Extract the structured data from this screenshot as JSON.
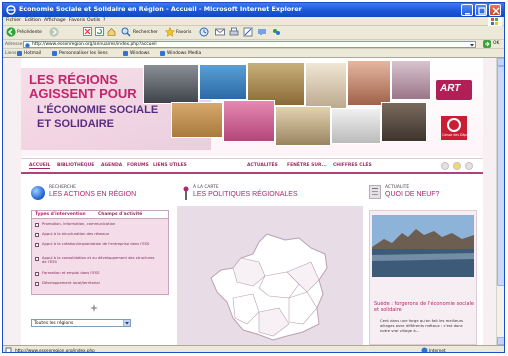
{
  "window": {
    "title": "Economie Sociale et Solidaire en Région - Accueil - Microsoft Internet Explorer"
  },
  "menu": [
    "Fichier",
    "Edition",
    "Affichage",
    "Favoris",
    "Outils",
    "?"
  ],
  "toolbar": {
    "back_label": "Précédente",
    "search_label": "Rechercher",
    "favorites_label": "Favoris"
  },
  "address": {
    "label": "Adresse",
    "url": "http://www.essenregion.org/annuaires/index.php?accueil",
    "go_label": "OK"
  },
  "links": {
    "label": "Liens",
    "items": [
      "Hotmail",
      "Personnaliser les liens",
      "Windows",
      "Windows Media"
    ]
  },
  "hero": {
    "line1": "LES RÉGIONS",
    "line2": "AGISSENT POUR",
    "line3": "L'ÉCONOMIE SOCIALE",
    "line4": "ET SOLIDAIRE",
    "art_logo": "ART",
    "cdc_logo": "Caisse des Dépôts"
  },
  "nav": {
    "items": [
      "ACCUEIL",
      "BIBLIOTHÈQUE",
      "AGENDA",
      "FORUMS",
      "LIENS UTILES",
      "ACTUALITÉS",
      "FENÊTRE SUR...",
      "CHIFFRES CLÉS"
    ]
  },
  "left": {
    "small": "RECHERCHE",
    "big": "LES ACTIONS EN RÉGION",
    "tab_a": "Types d'intervention",
    "tab_b": "Champs d'activité",
    "checks": [
      "Promotion, information, communication",
      "Appui à la structuration des réseaux",
      "Appui à la création/implantation de l'entreprise dans l'ESS",
      "Appui à la consolidation et au développement des structures de l'ESS",
      "Formation et emploi dans l'ESS",
      "Développement local/territorial"
    ],
    "select_value": "Toutes les régions"
  },
  "middle": {
    "small": "À LA CARTE",
    "big": "LES POLITIQUES RÉGIONALES"
  },
  "right": {
    "small": "ACTUALITÉ",
    "big": "QUOI DE NEUF?",
    "news_title": "Suède : forgerons de l'économie sociale et solidaire",
    "news_text": "Cent dans une forge qu'on fait les meilleurs alliages avec différents métaux : c'est donc notre vrai village à..."
  },
  "status": {
    "text": "http://www.essenregion.org/index.php",
    "zone": "Internet"
  },
  "colors": {
    "brand": "#b2266c",
    "nav": "#9b2a63",
    "xp_title": "#1a54d6"
  }
}
